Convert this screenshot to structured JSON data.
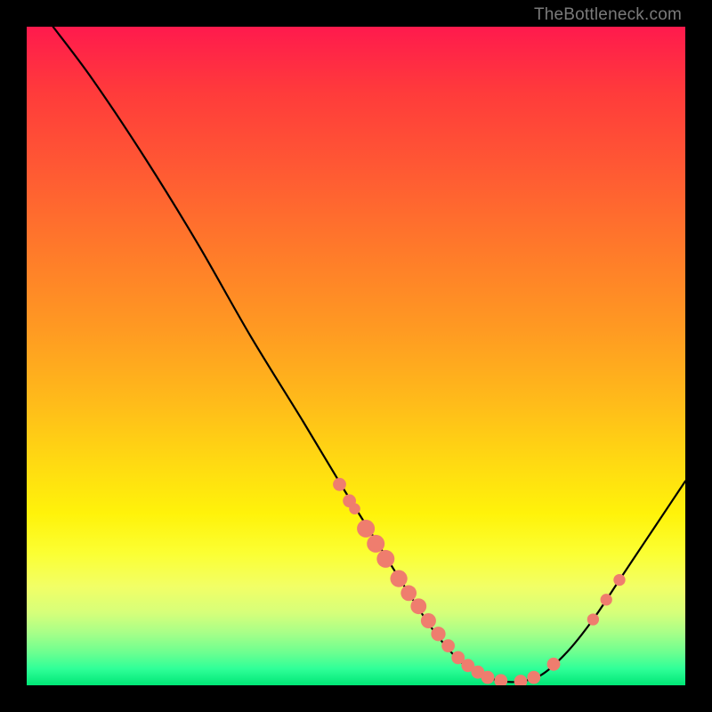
{
  "watermark": "TheBottleneck.com",
  "chart_data": {
    "type": "line",
    "title": "",
    "xlabel": "",
    "ylabel": "",
    "xlim": [
      0,
      100
    ],
    "ylim": [
      0,
      100
    ],
    "grid": false,
    "legend": false,
    "curve_points": [
      {
        "x": 4,
        "y": 100
      },
      {
        "x": 10,
        "y": 92
      },
      {
        "x": 18,
        "y": 80
      },
      {
        "x": 26,
        "y": 67
      },
      {
        "x": 34,
        "y": 53
      },
      {
        "x": 42,
        "y": 40
      },
      {
        "x": 48,
        "y": 30
      },
      {
        "x": 53,
        "y": 22
      },
      {
        "x": 58,
        "y": 14
      },
      {
        "x": 62,
        "y": 8
      },
      {
        "x": 66,
        "y": 3.5
      },
      {
        "x": 70,
        "y": 1.2
      },
      {
        "x": 74,
        "y": 0.5
      },
      {
        "x": 78,
        "y": 1.5
      },
      {
        "x": 82,
        "y": 5
      },
      {
        "x": 86,
        "y": 10
      },
      {
        "x": 90,
        "y": 16
      },
      {
        "x": 94,
        "y": 22
      },
      {
        "x": 98,
        "y": 28
      },
      {
        "x": 100,
        "y": 31
      }
    ],
    "markers": [
      {
        "x": 47.5,
        "y": 30.5,
        "r": 1.0
      },
      {
        "x": 49.0,
        "y": 28.0,
        "r": 1.0
      },
      {
        "x": 49.8,
        "y": 26.8,
        "r": 0.85
      },
      {
        "x": 51.5,
        "y": 23.8,
        "r": 1.35
      },
      {
        "x": 53.0,
        "y": 21.5,
        "r": 1.35
      },
      {
        "x": 54.5,
        "y": 19.2,
        "r": 1.35
      },
      {
        "x": 56.5,
        "y": 16.2,
        "r": 1.3
      },
      {
        "x": 58.0,
        "y": 14.0,
        "r": 1.2
      },
      {
        "x": 59.5,
        "y": 12.0,
        "r": 1.2
      },
      {
        "x": 61.0,
        "y": 9.8,
        "r": 1.15
      },
      {
        "x": 62.5,
        "y": 7.8,
        "r": 1.1
      },
      {
        "x": 64.0,
        "y": 6.0,
        "r": 1.0
      },
      {
        "x": 65.5,
        "y": 4.2,
        "r": 1.0
      },
      {
        "x": 67.0,
        "y": 3.0,
        "r": 1.0
      },
      {
        "x": 68.5,
        "y": 2.0,
        "r": 1.0
      },
      {
        "x": 70.0,
        "y": 1.2,
        "r": 1.0
      },
      {
        "x": 72.0,
        "y": 0.7,
        "r": 1.0
      },
      {
        "x": 75.0,
        "y": 0.6,
        "r": 1.0
      },
      {
        "x": 77.0,
        "y": 1.2,
        "r": 1.0
      },
      {
        "x": 80.0,
        "y": 3.2,
        "r": 1.0
      },
      {
        "x": 86.0,
        "y": 10.0,
        "r": 0.9
      },
      {
        "x": 88.0,
        "y": 13.0,
        "r": 0.9
      },
      {
        "x": 90.0,
        "y": 16.0,
        "r": 0.9
      }
    ],
    "colors": {
      "curve": "#000000",
      "marker": "#ef7d6e",
      "gradient_top": "#ff1a4d",
      "gradient_bottom": "#00e676"
    }
  }
}
